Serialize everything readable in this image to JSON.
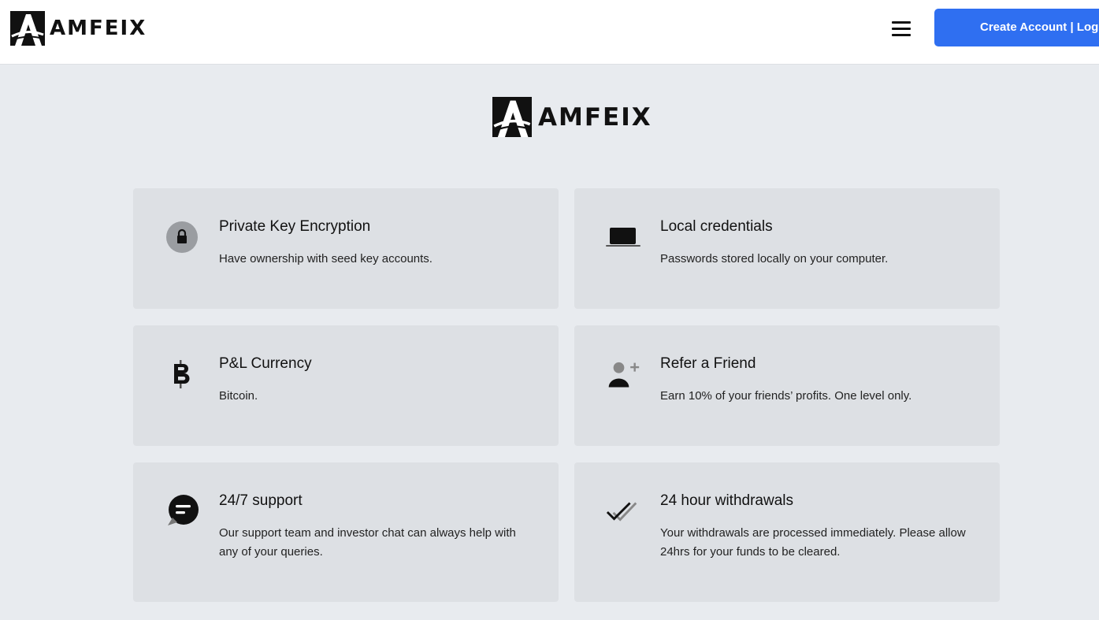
{
  "header": {
    "logo_text": "AMFEIX",
    "menu_icon": "hamburger-menu-icon",
    "cta_label": "Create Account | Log In"
  },
  "hero": {
    "logo_text": "AMFEIX"
  },
  "features": [
    {
      "icon": "lock-icon",
      "title": "Private Key Encryption",
      "description": "Have ownership with seed key accounts."
    },
    {
      "icon": "laptop-icon",
      "title": "Local credentials",
      "description": "Passwords stored locally on your computer."
    },
    {
      "icon": "bitcoin-icon",
      "title": "P&L Currency",
      "description": "Bitcoin."
    },
    {
      "icon": "add-user-icon",
      "title": "Refer a Friend",
      "description": "Earn 10% of your friends’ profits. One level only."
    },
    {
      "icon": "chat-bubble-icon",
      "title": "24/7 support",
      "description": "Our support team and investor chat can always help with any of your queries."
    },
    {
      "icon": "double-check-icon",
      "title": "24 hour withdrawals",
      "description": "Your withdrawals are processed immediately. Please allow 24hrs for your funds to be cleared."
    }
  ],
  "colors": {
    "accent": "#2f6ff1",
    "page_background": "#e8ebef",
    "card_background": "#dde0e4"
  }
}
